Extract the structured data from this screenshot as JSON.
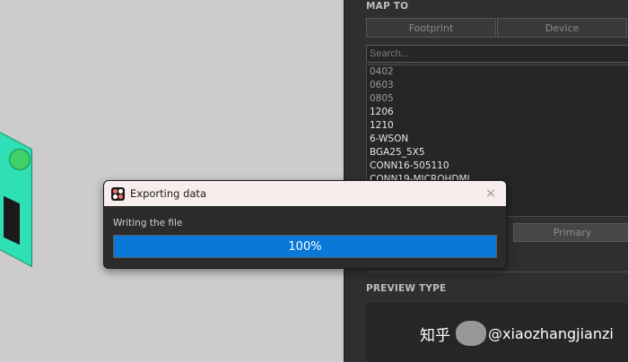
{
  "panel": {
    "map_to_title": "MAP TO",
    "tabs": [
      {
        "label": "Footprint"
      },
      {
        "label": "Device"
      },
      {
        "label": ""
      }
    ],
    "search": {
      "placeholder": "Search...",
      "value": ""
    },
    "list_items": [
      {
        "label": "0402",
        "dim": true
      },
      {
        "label": "0603",
        "dim": true
      },
      {
        "label": "0805",
        "dim": true
      },
      {
        "label": "1206",
        "dim": false
      },
      {
        "label": "1210",
        "dim": false
      },
      {
        "label": "6-WSON",
        "dim": false
      },
      {
        "label": "BGA25_5X5",
        "dim": false
      },
      {
        "label": "CONN16-505110",
        "dim": false
      },
      {
        "label": "CONN19-MICROHDMI",
        "dim": false
      }
    ],
    "role_button": "Primary",
    "preview_type_title": "PREVIEW TYPE"
  },
  "dialog": {
    "title": "Exporting data",
    "close_glyph": "✕",
    "status": "Writing the file",
    "progress": 100,
    "progress_label": "100%",
    "accent": "#0a78d7"
  },
  "watermark": {
    "mark": "知乎",
    "handle": "@xiaozhangjianzi"
  }
}
